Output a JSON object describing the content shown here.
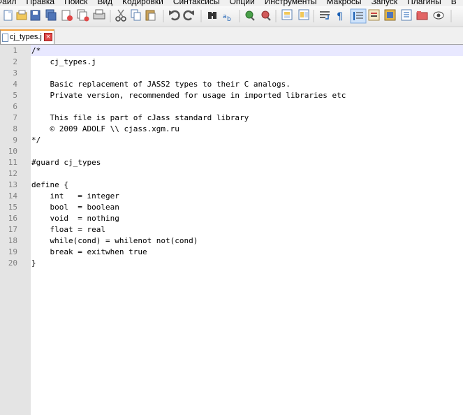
{
  "menu": [
    "Файл",
    "Правка",
    "Поиск",
    "Вид",
    "Кодировки",
    "Синтаксисы",
    "Опции",
    "Инструменты",
    "Макросы",
    "Запуск",
    "Плагины",
    "В"
  ],
  "toolbar_icons": [
    "new-file-icon",
    "open-file-icon",
    "save-icon",
    "save-all-icon",
    "close-icon",
    "close-all-icon",
    "print-icon",
    "cut-icon",
    "copy-icon",
    "paste-icon",
    "undo-icon",
    "redo-icon",
    "find-icon",
    "replace-icon",
    "zoom-in-icon",
    "zoom-out-icon",
    "sync-vertical-icon",
    "sync-horizontal-icon",
    "word-wrap-icon",
    "show-all-characters-icon",
    "indent-guide-icon",
    "user-language-icon",
    "document-map-icon",
    "function-list-icon",
    "folder-icon",
    "monitor-icon"
  ],
  "tab": {
    "label": "cj_types.j"
  },
  "editor": {
    "lines": [
      "/*",
      "    cj_types.j",
      "",
      "    Basic replacement of JASS2 types to their C analogs.",
      "    Private version, recommended for usage in imported libraries etc",
      "",
      "    This file is part of cJass standard library",
      "    © 2009 ADOLF \\\\ cjass.xgm.ru",
      "*/",
      "",
      "#guard cj_types",
      "",
      "define {",
      "    int   = integer",
      "    bool  = boolean",
      "    void  = nothing",
      "    float = real",
      "    while(cond) = whilenot not(cond)",
      "    break = exitwhen true",
      "}"
    ],
    "line_numbers": [
      "1",
      "2",
      "3",
      "4",
      "5",
      "6",
      "7",
      "8",
      "9",
      "10",
      "11",
      "12",
      "13",
      "14",
      "15",
      "16",
      "17",
      "18",
      "19",
      "20"
    ]
  },
  "colors": {
    "gutter": "#e4e4e4",
    "current_line": "#e8e8ff",
    "tab_accent": "#f2a03d"
  }
}
